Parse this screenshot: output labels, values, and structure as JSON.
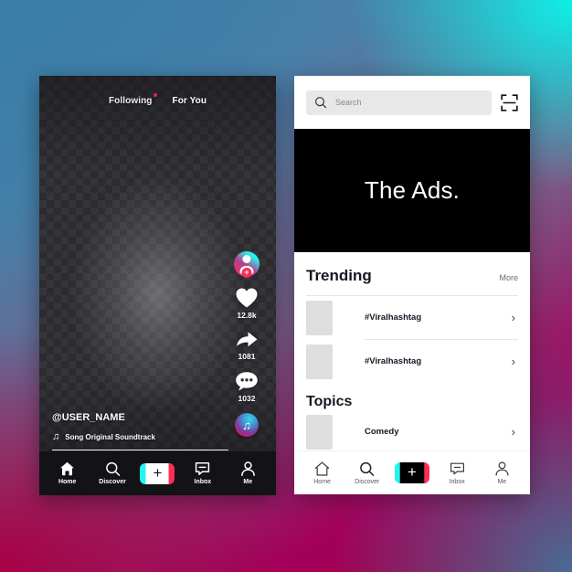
{
  "left_phone": {
    "tabs": [
      {
        "label": "Following",
        "has_dot": true
      },
      {
        "label": "For You",
        "has_dot": false
      }
    ],
    "action_rail": {
      "avatar": {
        "icon": "profile-avatar-icon",
        "plus": "+"
      },
      "like": {
        "icon": "heart-icon",
        "count": "12.8k"
      },
      "share": {
        "icon": "share-arrow-icon",
        "count": "1081"
      },
      "comment": {
        "icon": "comment-bubble-icon",
        "count": "1032"
      },
      "music_disc": {
        "icon": "music-disc-icon",
        "glyph": "♫"
      }
    },
    "caption": {
      "username": "@USER_NAME",
      "music_glyph": "♫",
      "song": "Song Original Soundtrack"
    },
    "floating_notes": {
      "note_large": "♪",
      "note_small": "♫"
    },
    "nav": [
      {
        "label": "Home",
        "icon": "home-icon"
      },
      {
        "label": "Discover",
        "icon": "search-icon"
      },
      {
        "label": "",
        "icon": "plus-create-icon",
        "glyph": "+"
      },
      {
        "label": "Inbox",
        "icon": "inbox-icon"
      },
      {
        "label": "Me",
        "icon": "person-icon"
      }
    ]
  },
  "right_phone": {
    "search": {
      "placeholder": "Search",
      "icon": "search-icon",
      "scan_icon": "scan-qr-icon"
    },
    "ads_banner": {
      "text": "The Ads."
    },
    "trending": {
      "title": "Trending",
      "more_label": "More",
      "items": [
        {
          "label": "#Viralhashtag",
          "chevron": "›"
        },
        {
          "label": "#Viralhashtag",
          "chevron": "›"
        }
      ]
    },
    "topics": {
      "title": "Topics",
      "items": [
        {
          "label": "Comedy",
          "chevron": "›"
        }
      ]
    },
    "nav": [
      {
        "label": "Home",
        "icon": "home-icon"
      },
      {
        "label": "Discover",
        "icon": "search-icon"
      },
      {
        "label": "",
        "icon": "plus-create-icon",
        "glyph": "+"
      },
      {
        "label": "Inbox",
        "icon": "inbox-icon"
      },
      {
        "label": "Me",
        "icon": "person-icon"
      }
    ]
  },
  "colors": {
    "brand_cyan": "#25f4ee",
    "brand_pink": "#fe2c55",
    "dark": "#161823",
    "bg_teal": "#0ef0e8",
    "bg_magenta": "#a80044"
  }
}
